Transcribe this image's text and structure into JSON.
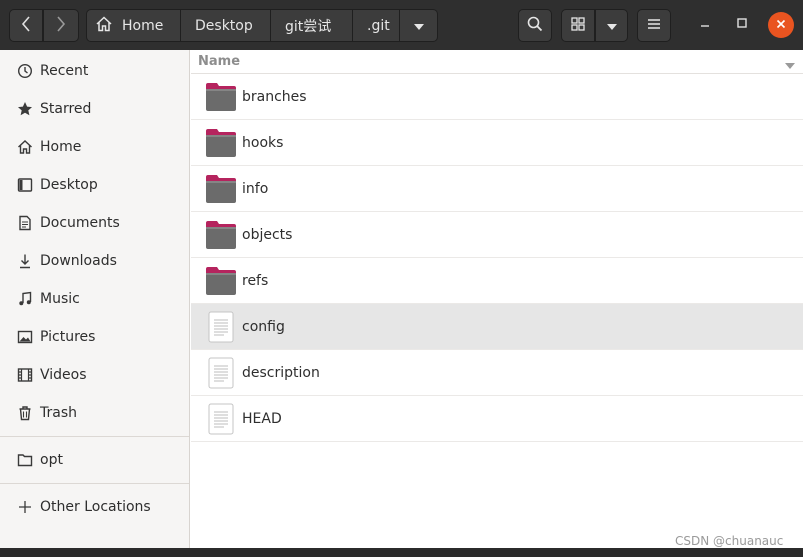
{
  "headerbar": {
    "nav": {
      "back_icon": "chevron-left-icon",
      "forward_icon": "chevron-right-icon"
    },
    "path": [
      {
        "label": "Home",
        "icon": "home-icon"
      },
      {
        "label": "Desktop"
      },
      {
        "label": "git尝试"
      },
      {
        "label": ".git"
      }
    ],
    "path_dropdown_icon": "triangle-down-icon",
    "search_icon": "search-icon",
    "view_icon": "grid-view-icon",
    "view_dropdown_icon": "triangle-down-icon",
    "menu_icon": "hamburger-menu-icon",
    "window_controls": {
      "minimize": "minimize-icon",
      "maximize": "maximize-icon",
      "close": "close-icon",
      "close_color": "#e95420"
    }
  },
  "sidebar": {
    "items": [
      {
        "label": "Recent",
        "icon": "clock-icon"
      },
      {
        "label": "Starred",
        "icon": "star-icon"
      },
      {
        "label": "Home",
        "icon": "home-icon"
      },
      {
        "label": "Desktop",
        "icon": "desktop-icon"
      },
      {
        "label": "Documents",
        "icon": "document-icon"
      },
      {
        "label": "Downloads",
        "icon": "download-icon"
      },
      {
        "label": "Music",
        "icon": "music-note-icon"
      },
      {
        "label": "Pictures",
        "icon": "picture-icon"
      },
      {
        "label": "Videos",
        "icon": "film-icon"
      },
      {
        "label": "Trash",
        "icon": "trash-icon"
      },
      {
        "label": "opt",
        "icon": "folder-icon"
      },
      {
        "label": "Other Locations",
        "icon": "plus-icon"
      }
    ]
  },
  "content": {
    "column_header": "Name",
    "files": [
      {
        "name": "branches",
        "type": "folder"
      },
      {
        "name": "hooks",
        "type": "folder"
      },
      {
        "name": "info",
        "type": "folder"
      },
      {
        "name": "objects",
        "type": "folder"
      },
      {
        "name": "refs",
        "type": "folder"
      },
      {
        "name": "config",
        "type": "file",
        "selected": true
      },
      {
        "name": "description",
        "type": "file"
      },
      {
        "name": "HEAD",
        "type": "file"
      }
    ]
  },
  "watermark": "CSDN @chuanauc"
}
